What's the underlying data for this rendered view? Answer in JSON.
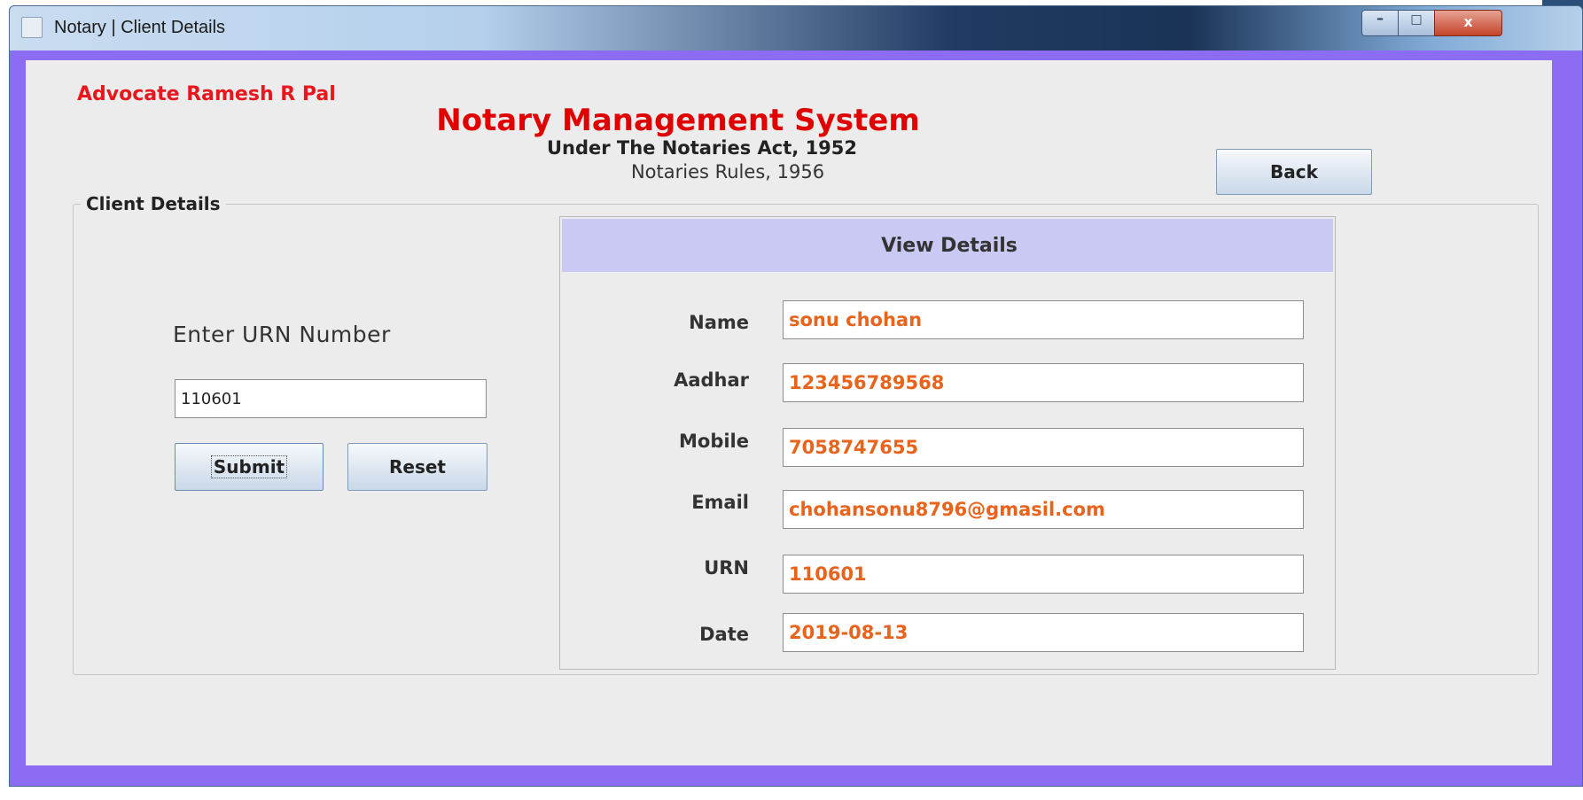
{
  "window": {
    "title": "Notary | Client Details",
    "controls": {
      "minimize": "–",
      "maximize": "□",
      "close": "x"
    }
  },
  "header": {
    "advocate": "Advocate Ramesh R Pal",
    "app_title": "Notary Management System",
    "act": "Under The Notaries Act, 1952",
    "rules": "Notaries Rules, 1956",
    "back_label": "Back"
  },
  "client_details": {
    "legend": "Client Details",
    "urn_label": "Enter URN Number",
    "urn_value": "110601",
    "submit_label": "Submit",
    "reset_label": "Reset"
  },
  "view_details": {
    "title": "View Details",
    "fields": [
      {
        "label": "Name",
        "value": "sonu chohan"
      },
      {
        "label": "Aadhar",
        "value": "123456789568"
      },
      {
        "label": "Mobile",
        "value": "7058747655"
      },
      {
        "label": "Email",
        "value": "chohansonu8796@gmasil.com"
      },
      {
        "label": "URN",
        "value": "110601"
      },
      {
        "label": "Date",
        "value": "2019-08-13"
      }
    ]
  },
  "colors": {
    "frame_border": "#8c6cf2",
    "title_red": "#e00000",
    "value_orange": "#e8641c",
    "view_header": "#c9c9f4"
  }
}
